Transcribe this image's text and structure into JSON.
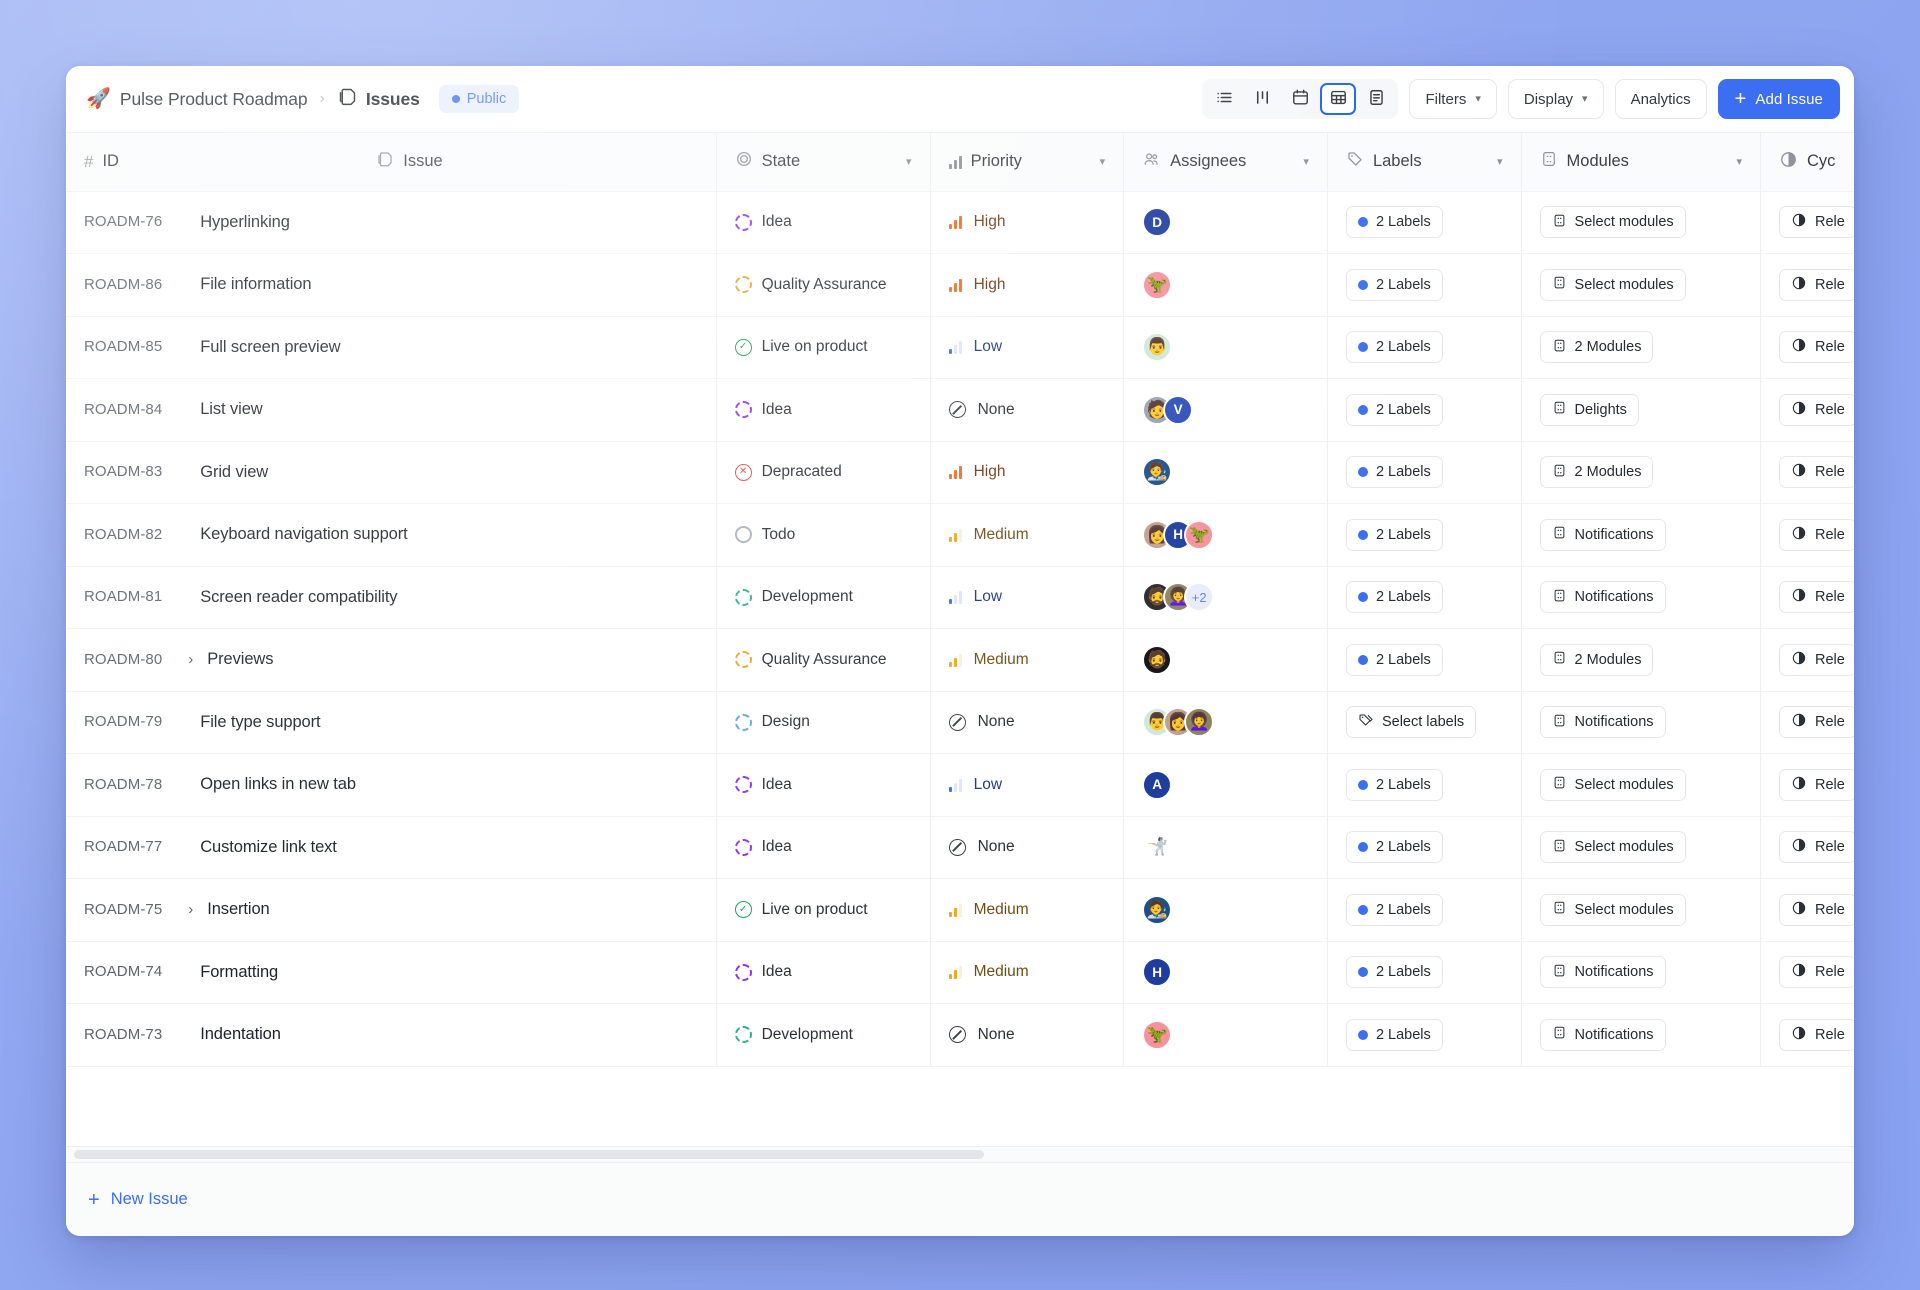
{
  "header": {
    "rocket_icon": "rocket-icon",
    "project": "Pulse Product Roadmap",
    "separator": "›",
    "section": "Issues",
    "visibility_badge": "Public",
    "views": [
      {
        "name": "list-view",
        "icon": "list-icon",
        "active": false
      },
      {
        "name": "kanban-view",
        "icon": "kanban-icon",
        "active": false
      },
      {
        "name": "calendar-view",
        "icon": "calendar-icon",
        "active": false
      },
      {
        "name": "spreadsheet-view",
        "icon": "table-icon",
        "active": true
      },
      {
        "name": "gantt-view",
        "icon": "document-icon",
        "active": false
      }
    ],
    "filters_label": "Filters",
    "display_label": "Display",
    "analytics_label": "Analytics",
    "add_issue_label": "Add Issue",
    "add_issue_plus": "+",
    "accent_color": "#3b6ef0",
    "badge_bg": "#e8eefc"
  },
  "columns": [
    {
      "key": "id",
      "label": "ID",
      "icon": "hash-icon",
      "chevron": false
    },
    {
      "key": "issue",
      "label": "Issue",
      "icon": "layers-icon",
      "chevron": false
    },
    {
      "key": "state",
      "label": "State",
      "icon": "circle-icon",
      "chevron": true
    },
    {
      "key": "priority",
      "label": "Priority",
      "icon": "bars-icon",
      "chevron": true
    },
    {
      "key": "assignees",
      "label": "Assignees",
      "icon": "people-icon",
      "chevron": true
    },
    {
      "key": "labels",
      "label": "Labels",
      "icon": "tag-icon",
      "chevron": true
    },
    {
      "key": "modules",
      "label": "Modules",
      "icon": "grid-icon",
      "chevron": true
    },
    {
      "key": "cycle",
      "label": "Cyc",
      "icon": "contrast-icon",
      "chevron": false
    }
  ],
  "rows": [
    {
      "id": "ROADM-76",
      "title": "Hyperlinking",
      "expandable": false,
      "state": "Idea",
      "state_kind": "dashed",
      "state_color": "#9333ea",
      "priority": "High",
      "priority_level": 3,
      "assignees": [
        {
          "type": "initial",
          "text": "D",
          "color": "#1f3d9e"
        }
      ],
      "labels": "2 Labels",
      "labels_has_dot": true,
      "modules": "Select modules",
      "cycle": "Rele"
    },
    {
      "id": "ROADM-86",
      "title": "File information",
      "expandable": false,
      "state": "Quality Assurance",
      "state_kind": "dashed",
      "state_color": "#f0a32a",
      "priority": "High",
      "priority_level": 3,
      "assignees": [
        {
          "type": "photo",
          "color": "#f7909f",
          "emoji": "🦖"
        }
      ],
      "labels": "2 Labels",
      "labels_has_dot": true,
      "modules": "Select modules",
      "cycle": "Rele"
    },
    {
      "id": "ROADM-85",
      "title": "Full screen preview",
      "expandable": false,
      "state": "Live on product",
      "state_kind": "check",
      "state_color": "#15a55a",
      "priority": "Low",
      "priority_level": 1,
      "assignees": [
        {
          "type": "photo",
          "color": "#cfe8d8",
          "emoji": "👨"
        }
      ],
      "labels": "2 Labels",
      "labels_has_dot": true,
      "modules": "2 Modules",
      "cycle": "Rele"
    },
    {
      "id": "ROADM-84",
      "title": "List view",
      "expandable": false,
      "state": "Idea",
      "state_kind": "dashed",
      "state_color": "#9333ea",
      "priority": "None",
      "priority_level": 0,
      "assignees": [
        {
          "type": "photo",
          "color": "#9aa3ae",
          "emoji": "🧑"
        },
        {
          "type": "initial",
          "text": "V",
          "color": "#2d4eb8"
        }
      ],
      "labels": "2 Labels",
      "labels_has_dot": true,
      "modules": "Delights",
      "cycle": "Rele"
    },
    {
      "id": "ROADM-83",
      "title": "Grid view",
      "expandable": false,
      "state": "Depracated",
      "state_kind": "cross",
      "state_color": "#ef4444",
      "priority": "High",
      "priority_level": 3,
      "assignees": [
        {
          "type": "photo",
          "color": "#1d4f8b",
          "emoji": "🧑‍🎨"
        }
      ],
      "labels": "2 Labels",
      "labels_has_dot": true,
      "modules": "2 Modules",
      "cycle": "Rele"
    },
    {
      "id": "ROADM-82",
      "title": "Keyboard navigation support",
      "expandable": false,
      "state": "Todo",
      "state_kind": "plain",
      "state_color": "#aab1bd",
      "priority": "Medium",
      "priority_level": 2,
      "assignees": [
        {
          "type": "photo",
          "color": "#c2a090",
          "emoji": "👩"
        },
        {
          "type": "initial",
          "text": "H",
          "color": "#1f3d9e"
        },
        {
          "type": "photo",
          "color": "#f7909f",
          "emoji": "🦖"
        }
      ],
      "labels": "2 Labels",
      "labels_has_dot": true,
      "modules": "Notifications",
      "cycle": "Rele"
    },
    {
      "id": "ROADM-81",
      "title": "Screen reader compatibility",
      "expandable": false,
      "state": "Development",
      "state_kind": "dashed",
      "state_color": "#2bb58c",
      "priority": "Low",
      "priority_level": 1,
      "assignees": [
        {
          "type": "photo",
          "color": "#26282c",
          "emoji": "🧔"
        },
        {
          "type": "photo",
          "color": "#8d8364",
          "emoji": "👩‍🦱"
        },
        {
          "type": "more",
          "text": "+2"
        }
      ],
      "labels": "2 Labels",
      "labels_has_dot": true,
      "modules": "Notifications",
      "cycle": "Rele"
    },
    {
      "id": "ROADM-80",
      "title": "Previews",
      "expandable": true,
      "state": "Quality Assurance",
      "state_kind": "dashed",
      "state_color": "#f0a32a",
      "priority": "Medium",
      "priority_level": 2,
      "assignees": [
        {
          "type": "photo",
          "color": "#141414",
          "emoji": "🧔"
        }
      ],
      "labels": "2 Labels",
      "labels_has_dot": true,
      "modules": "2 Modules",
      "cycle": "Rele"
    },
    {
      "id": "ROADM-79",
      "title": "File type support",
      "expandable": false,
      "state": "Design",
      "state_kind": "dashed",
      "state_color": "#5aa9e6",
      "priority": "None",
      "priority_level": 0,
      "assignees": [
        {
          "type": "photo",
          "color": "#cfe8d8",
          "emoji": "👨"
        },
        {
          "type": "photo",
          "color": "#c2a090",
          "emoji": "👩"
        },
        {
          "type": "photo",
          "color": "#8d8364",
          "emoji": "👩‍🦱"
        }
      ],
      "labels": "Select labels",
      "labels_has_dot": false,
      "modules": "Notifications",
      "cycle": "Rele"
    },
    {
      "id": "ROADM-78",
      "title": "Open links in new tab",
      "expandable": false,
      "state": "Idea",
      "state_kind": "dashed",
      "state_color": "#9333ea",
      "priority": "Low",
      "priority_level": 1,
      "assignees": [
        {
          "type": "initial",
          "text": "A",
          "color": "#1f3d9e"
        }
      ],
      "labels": "2 Labels",
      "labels_has_dot": true,
      "modules": "Select modules",
      "cycle": "Rele"
    },
    {
      "id": "ROADM-77",
      "title": "Customize link text",
      "expandable": false,
      "state": "Idea",
      "state_kind": "dashed",
      "state_color": "#9333ea",
      "priority": "None",
      "priority_level": 0,
      "assignees": [
        {
          "type": "photo",
          "color": "#ffffff",
          "emoji": "🤺"
        }
      ],
      "labels": "2 Labels",
      "labels_has_dot": true,
      "modules": "Select modules",
      "cycle": "Rele"
    },
    {
      "id": "ROADM-75",
      "title": "Insertion",
      "expandable": true,
      "state": "Live on product",
      "state_kind": "check",
      "state_color": "#15a55a",
      "priority": "Medium",
      "priority_level": 2,
      "assignees": [
        {
          "type": "photo",
          "color": "#1d4f8b",
          "emoji": "🧑‍🎨"
        }
      ],
      "labels": "2 Labels",
      "labels_has_dot": true,
      "modules": "Select modules",
      "cycle": "Rele"
    },
    {
      "id": "ROADM-74",
      "title": "Formatting",
      "expandable": false,
      "state": "Idea",
      "state_kind": "dashed",
      "state_color": "#9333ea",
      "priority": "Medium",
      "priority_level": 2,
      "assignees": [
        {
          "type": "initial",
          "text": "H",
          "color": "#1f3d9e"
        }
      ],
      "labels": "2 Labels",
      "labels_has_dot": true,
      "modules": "Notifications",
      "cycle": "Rele"
    },
    {
      "id": "ROADM-73",
      "title": "Indentation",
      "expandable": false,
      "state": "Development",
      "state_kind": "dashed",
      "state_color": "#2bb58c",
      "priority": "None",
      "priority_level": 0,
      "assignees": [
        {
          "type": "photo",
          "color": "#f7909f",
          "emoji": "🦖"
        }
      ],
      "labels": "2 Labels",
      "labels_has_dot": true,
      "modules": "Notifications",
      "cycle": "Rele"
    }
  ],
  "footer": {
    "new_issue_label": "New Issue",
    "plus": "+"
  }
}
